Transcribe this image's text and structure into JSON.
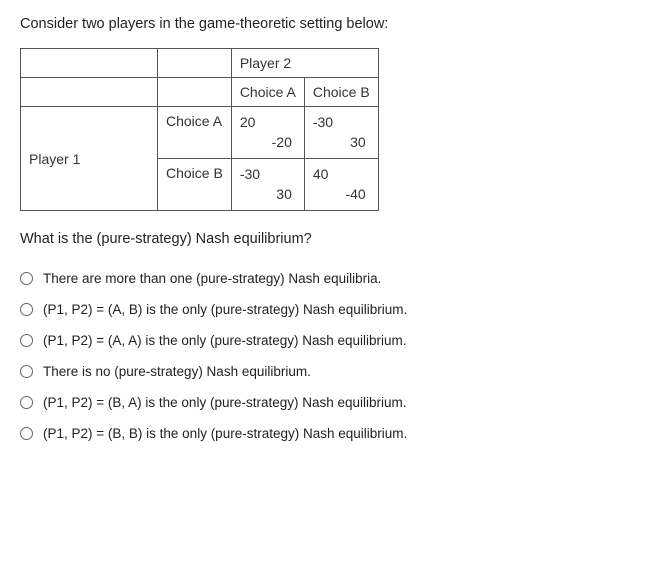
{
  "prompt": "Consider two players in the game-theoretic setting below:",
  "table": {
    "player2_header": "Player 2",
    "player1_header": "Player 1",
    "col_choice_a": "Choice A",
    "col_choice_b": "Choice B",
    "row_choice_a": "Choice A",
    "row_choice_b": "Choice B",
    "payoffs": {
      "aa": {
        "p1": "20",
        "p2": "-20"
      },
      "ab": {
        "p1": "-30",
        "p2": "30"
      },
      "ba": {
        "p1": "-30",
        "p2": "30"
      },
      "bb": {
        "p1": "40",
        "p2": "-40"
      }
    }
  },
  "question": "What is the (pure-strategy) Nash equilibrium?",
  "answers": [
    "There are more than one (pure-strategy) Nash equilibria.",
    "(P1, P2) = (A, B) is the only (pure-strategy) Nash equilibrium.",
    "(P1, P2) = (A, A) is the only (pure-strategy) Nash equilibrium.",
    "There is no (pure-strategy) Nash equilibrium.",
    "(P1, P2) = (B, A) is the only (pure-strategy) Nash equilibrium.",
    "(P1, P2) = (B, B) is the only (pure-strategy) Nash equilibrium."
  ],
  "chart_data": {
    "type": "table",
    "title": "Two-player payoff matrix",
    "rows": [
      "Player 1: Choice A",
      "Player 1: Choice B"
    ],
    "cols": [
      "Player 2: Choice A",
      "Player 2: Choice B"
    ],
    "cells": [
      [
        {
          "p1": 20,
          "p2": -20
        },
        {
          "p1": -30,
          "p2": 30
        }
      ],
      [
        {
          "p1": -30,
          "p2": 30
        },
        {
          "p1": 40,
          "p2": -40
        }
      ]
    ]
  }
}
